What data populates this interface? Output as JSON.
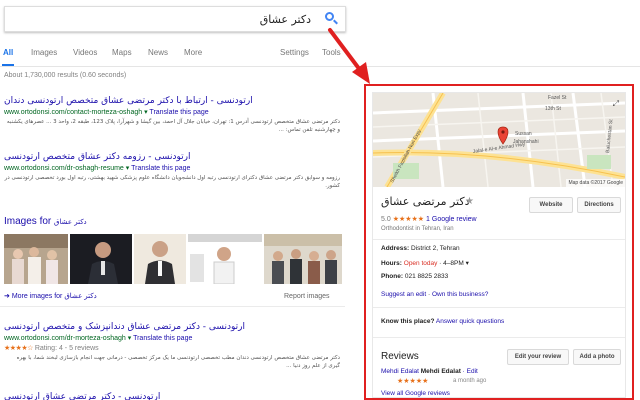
{
  "search": {
    "query": "دکتر عشاق"
  },
  "tabs": [
    "All",
    "Images",
    "Videos",
    "Maps",
    "News",
    "More",
    "Settings",
    "Tools"
  ],
  "stats": "About 1,730,000 results (0.60 seconds)",
  "results": [
    {
      "title": "ارتودنسی - ارتباط با دکتر مرتضی عشاق متخصص ارتودنسی دندان",
      "url": "www.ortodonsi.com/contact-morteza-oshagh",
      "translate": "Translate this page",
      "snippet": "دکتر مرتضی عشاق متخصص ارتودنسی آدرس 1: تهران، خیابان جلال آل احمد، بین گیشا و شهرآرا، پلاک 123، طبقه 2، واحد 3 ... عصرهای یکشنبه و چهارشنبه تلفن تماس: ..."
    },
    {
      "title": "ارتودنسی - رزومه دکتر عشاق متخصص ارتودنسی",
      "url": "www.ortodonsi.com/dr-oshagh-resume",
      "translate": "Translate this page",
      "snippet": "رزومه و سوابق دکتر مرتضی عشاق دکترای ارتودنسی رتبه اول دانشجویان دانشگاه علوم پزشکی شهید بهشتی، رتبه اول بورد تخصصی ارتودنسی در کشور."
    },
    {
      "title": "ارتودنسی - دکتر مرتضی عشاق دندانپزشک و متخصص ارتودنسی",
      "url": "www.ortodonsi.com/dr-morteza-oshagh",
      "translate": "Translate this page",
      "rating_text": "Rating: 4 - 5 reviews",
      "stars": "★★★★☆",
      "snippet": "دکتر مرتضی عشاق متخصص ارتودنسی دندان مطب تخصصی ارتودنسی ما یک مرکز تخصصی - درمانی جهت انجام بازسازی لبخند شما، با بهره گیری از علم روز دنیا ..."
    }
  ],
  "images_section": {
    "label": "Images for",
    "query": "دکتر عشاق",
    "more_label": "More images for",
    "more_query": "دکتر عشاق",
    "report": "Report images"
  },
  "next_title": "ارتودنسی - دکتر مرتضی عشاق ارتودنسی",
  "knowledge_panel": {
    "map_credit": "Map data ©2017 Google",
    "map_labels": [
      "13th St",
      "Jalal-e Al-e Ahmad Hwy",
      "Sheikh Fazlollah Nuri Expy",
      "Sussan",
      "Jahanshahi",
      "Fazel St",
      "Baluchestan St"
    ],
    "name": "دکتر مرتضی عشاق",
    "rating_value": "5.0",
    "stars": "★★★★★",
    "review_count": "1 Google review",
    "type": "Orthodontist in Tehran, Iran",
    "website_btn": "Website",
    "directions_btn": "Directions",
    "address_label": "Address:",
    "address": "District 2, Tehran",
    "hours_label": "Hours:",
    "hours_status": "Open today",
    "hours_time": "4–8PM",
    "phone_label": "Phone:",
    "phone": "021 8825 2833",
    "suggest_edit": "Suggest an edit",
    "own_business": "Own this business?",
    "know_label": "Know this place?",
    "answer_link": "Answer quick questions",
    "reviews_heading": "Reviews",
    "edit_review_btn": "Edit your review",
    "add_photo_btn": "Add a photo",
    "reviewer_1": "Mehdi Edalat",
    "reviewer_2": "Mehdi Edalat",
    "edit_link": "Edit",
    "review_stars": "★★★★★",
    "review_time": "a month ago",
    "view_all": "View all Google reviews"
  }
}
